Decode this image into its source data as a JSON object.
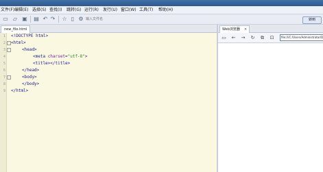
{
  "menu": [
    "文件(F)",
    "编辑(E)",
    "选择(S)",
    "查找(I)",
    "跳转(G)",
    "运行(R)",
    "发行(U)",
    "窗口(W)",
    "工具(T)",
    "帮助(H)"
  ],
  "toolbar": {
    "address_placeholder": "输入文件名",
    "go_label": "转到",
    "icons": [
      "new-file-icon",
      "open-folder-icon",
      "save-icon",
      "save-all-icon",
      "undo-icon",
      "redo-icon",
      "refresh-icon",
      "star-icon",
      "document-icon",
      "settings-icon"
    ]
  },
  "editor": {
    "tab_label": "new_file.html",
    "lines": [
      {
        "n": "1",
        "fold": "",
        "indent": 0,
        "text": "<!DOCTYPE html>"
      },
      {
        "n": "2",
        "fold": "-",
        "indent": 0,
        "text": "<html>"
      },
      {
        "n": "3",
        "fold": "-",
        "indent": 1,
        "text": "<head>"
      },
      {
        "n": "4",
        "fold": "",
        "indent": 2,
        "text": "<meta charset=\"utf-8\">"
      },
      {
        "n": "5",
        "fold": "",
        "indent": 2,
        "text": "<title></title>"
      },
      {
        "n": "6",
        "fold": "",
        "indent": 1,
        "text": "</head>"
      },
      {
        "n": "7",
        "fold": "-",
        "indent": 1,
        "text": "<body>"
      },
      {
        "n": "8",
        "fold": "",
        "indent": 1,
        "text": "</body>"
      },
      {
        "n": "9",
        "fold": "",
        "indent": 0,
        "text": "</html>"
      }
    ]
  },
  "browser": {
    "tab_label": "Web浏览器",
    "close_label": "×",
    "url": "file:///C:/Users/Administrator/Documents/HBuilderProjects/new_file.html"
  },
  "colors": {
    "editor_bg": "#fbf8e1",
    "code_text": "#1a1a8c",
    "attr": "#7a1fa2",
    "string": "#2a8a2a"
  }
}
